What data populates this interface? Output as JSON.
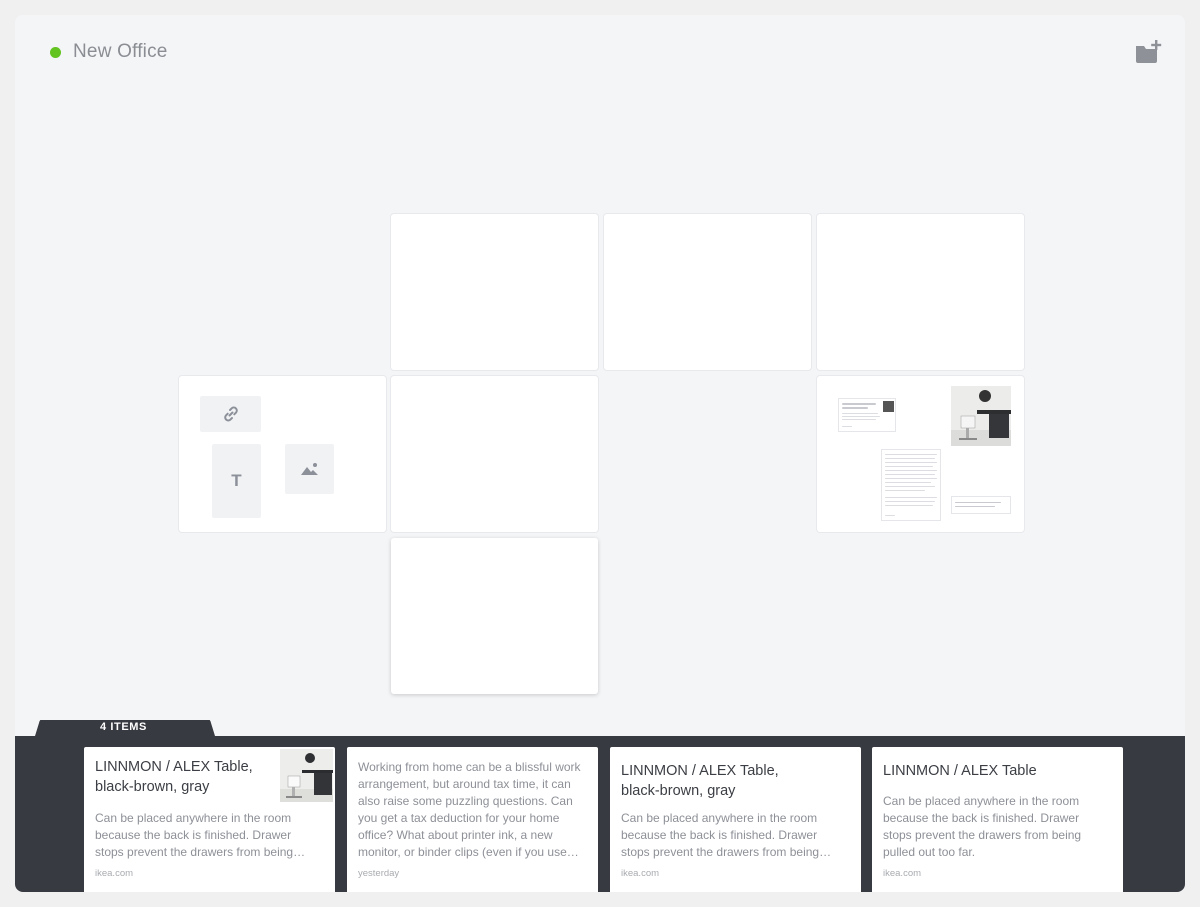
{
  "header": {
    "board_title": "New Office",
    "status_color": "#62c321",
    "add_board_icon": "add-board-icon"
  },
  "canvas": {
    "tools": {
      "link_icon": "link-icon",
      "text_label": "T",
      "image_icon": "image-icon"
    }
  },
  "tray": {
    "label": "4 ITEMS",
    "cards": [
      {
        "title": "LINNMON / ALEX Table, black-brown, gray",
        "description": "Can be placed anywhere in the room because the back is finished. Drawer stops prevent the drawers from being…",
        "source": "ikea.com",
        "has_thumbnail": true
      },
      {
        "title": "",
        "description": "Working from home can be a blissful work arrangement, but around tax time, it can also raise some puzzling questions. Can you get a tax deduction for your home office? What about printer ink, a new monitor, or binder clips (even if you use…",
        "source": "yesterday",
        "has_thumbnail": false
      },
      {
        "title": "LINNMON / ALEX Table, black-brown, gray",
        "description": "Can be placed anywhere in the room because the back is finished. Drawer stops prevent the drawers from being…",
        "source": "ikea.com",
        "has_thumbnail": false
      },
      {
        "title": "LINNMON / ALEX Table",
        "description": "Can be placed anywhere in the room because the back is finished. Drawer stops prevent the drawers from being pulled out too far.",
        "source": "ikea.com",
        "has_thumbnail": false
      }
    ]
  },
  "colors": {
    "tray_background": "#383a41",
    "canvas_background": "#f4f5f7",
    "accent_green": "#62c321"
  }
}
